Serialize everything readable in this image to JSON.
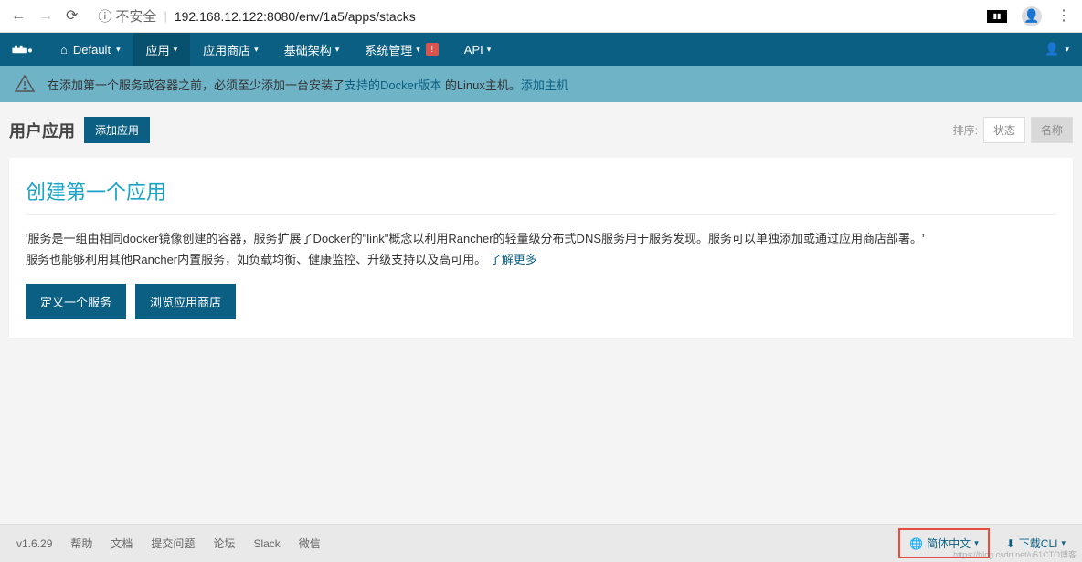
{
  "browser": {
    "insecure_label": "不安全",
    "url": "192.168.12.122:8080/env/1a5/apps/stacks"
  },
  "nav": {
    "env_label": "Default",
    "items": [
      {
        "label": "应用",
        "active": true
      },
      {
        "label": "应用商店",
        "active": false
      },
      {
        "label": "基础架构",
        "active": false
      },
      {
        "label": "系统管理",
        "active": false,
        "warn": "!"
      },
      {
        "label": "API",
        "active": false
      }
    ]
  },
  "banner": {
    "text_before": "在添加第一个服务或容器之前，必须至少添加一台安装了",
    "link1": "支持的Docker版本",
    "text_mid": " 的Linux主机。",
    "link2": "添加主机"
  },
  "page": {
    "title": "用户应用",
    "add_button": "添加应用",
    "sort_label": "排序:",
    "sort_status": "状态",
    "sort_name": "名称"
  },
  "panel": {
    "heading": "创建第一个应用",
    "p1": "'服务是一组由相同docker镜像创建的容器，服务扩展了Docker的\"link\"概念以利用Rancher的轻量级分布式DNS服务用于服务发现。服务可以单独添加或通过应用商店部署。'",
    "p2_before": "服务也能够利用其他Rancher内置服务，如负载均衡、健康监控、升级支持以及高可用。 ",
    "p2_link": "了解更多",
    "btn_define": "定义一个服务",
    "btn_browse": "浏览应用商店"
  },
  "footer": {
    "version": "v1.6.29",
    "links": [
      "帮助",
      "文档",
      "提交问题",
      "论坛",
      "Slack",
      "微信"
    ],
    "lang": "简体中文",
    "download": "下载CLI"
  },
  "watermark": "https://blog.csdn.net/u51CTO博客"
}
